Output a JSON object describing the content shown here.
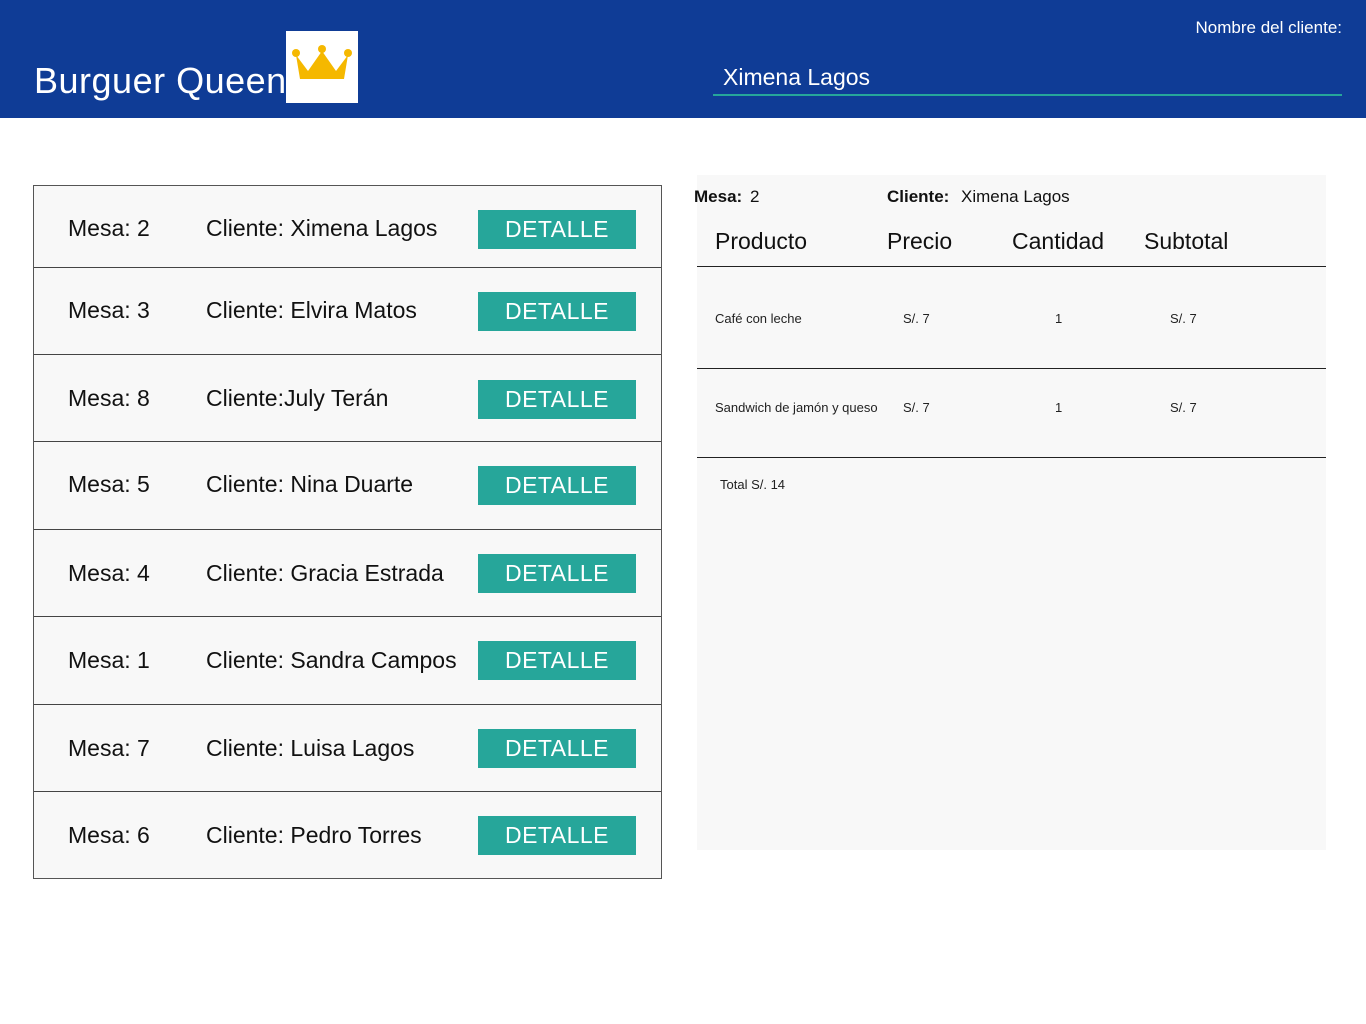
{
  "header": {
    "brand": "Burguer Queen",
    "logo_icon": "crown-icon",
    "client_label": "Nombre del cliente:",
    "client_value": "Ximena Lagos"
  },
  "orders": [
    {
      "mesa": "Mesa: 2",
      "cliente": "Cliente: Ximena Lagos",
      "button": "DETALLE"
    },
    {
      "mesa": "Mesa: 3",
      "cliente": "Cliente: Elvira Matos",
      "button": "DETALLE"
    },
    {
      "mesa": "Mesa: 8",
      "cliente": "Cliente:July Terán",
      "button": "DETALLE"
    },
    {
      "mesa": "Mesa: 5",
      "cliente": "Cliente: Nina Duarte",
      "button": "DETALLE"
    },
    {
      "mesa": "Mesa: 4",
      "cliente": "Cliente: Gracia Estrada",
      "button": "DETALLE"
    },
    {
      "mesa": "Mesa: 1",
      "cliente": "Cliente: Sandra Campos",
      "button": "DETALLE"
    },
    {
      "mesa": "Mesa: 7",
      "cliente": "Cliente: Luisa Lagos",
      "button": "DETALLE"
    },
    {
      "mesa": "Mesa: 6",
      "cliente": "Cliente: Pedro Torres",
      "button": "DETALLE"
    }
  ],
  "detail": {
    "mesa_label": "Mesa:",
    "mesa_value": "2",
    "cliente_label": "Cliente:",
    "cliente_value": "Ximena Lagos",
    "columns": [
      "Producto",
      "Precio",
      "Cantidad",
      "Subtotal"
    ],
    "items": [
      {
        "producto": "Café con leche",
        "precio": "S/. 7",
        "cantidad": "1",
        "subtotal": "S/. 7"
      },
      {
        "producto": "Sandwich de jamón y queso",
        "precio": "S/. 7",
        "cantidad": "1",
        "subtotal": "S/. 7"
      }
    ],
    "total": "Total S/. 14"
  },
  "colors": {
    "header_bg": "#0f3c96",
    "accent": "#26a69a",
    "crown": "#f5b800",
    "panel_bg": "#f8f8f8"
  }
}
